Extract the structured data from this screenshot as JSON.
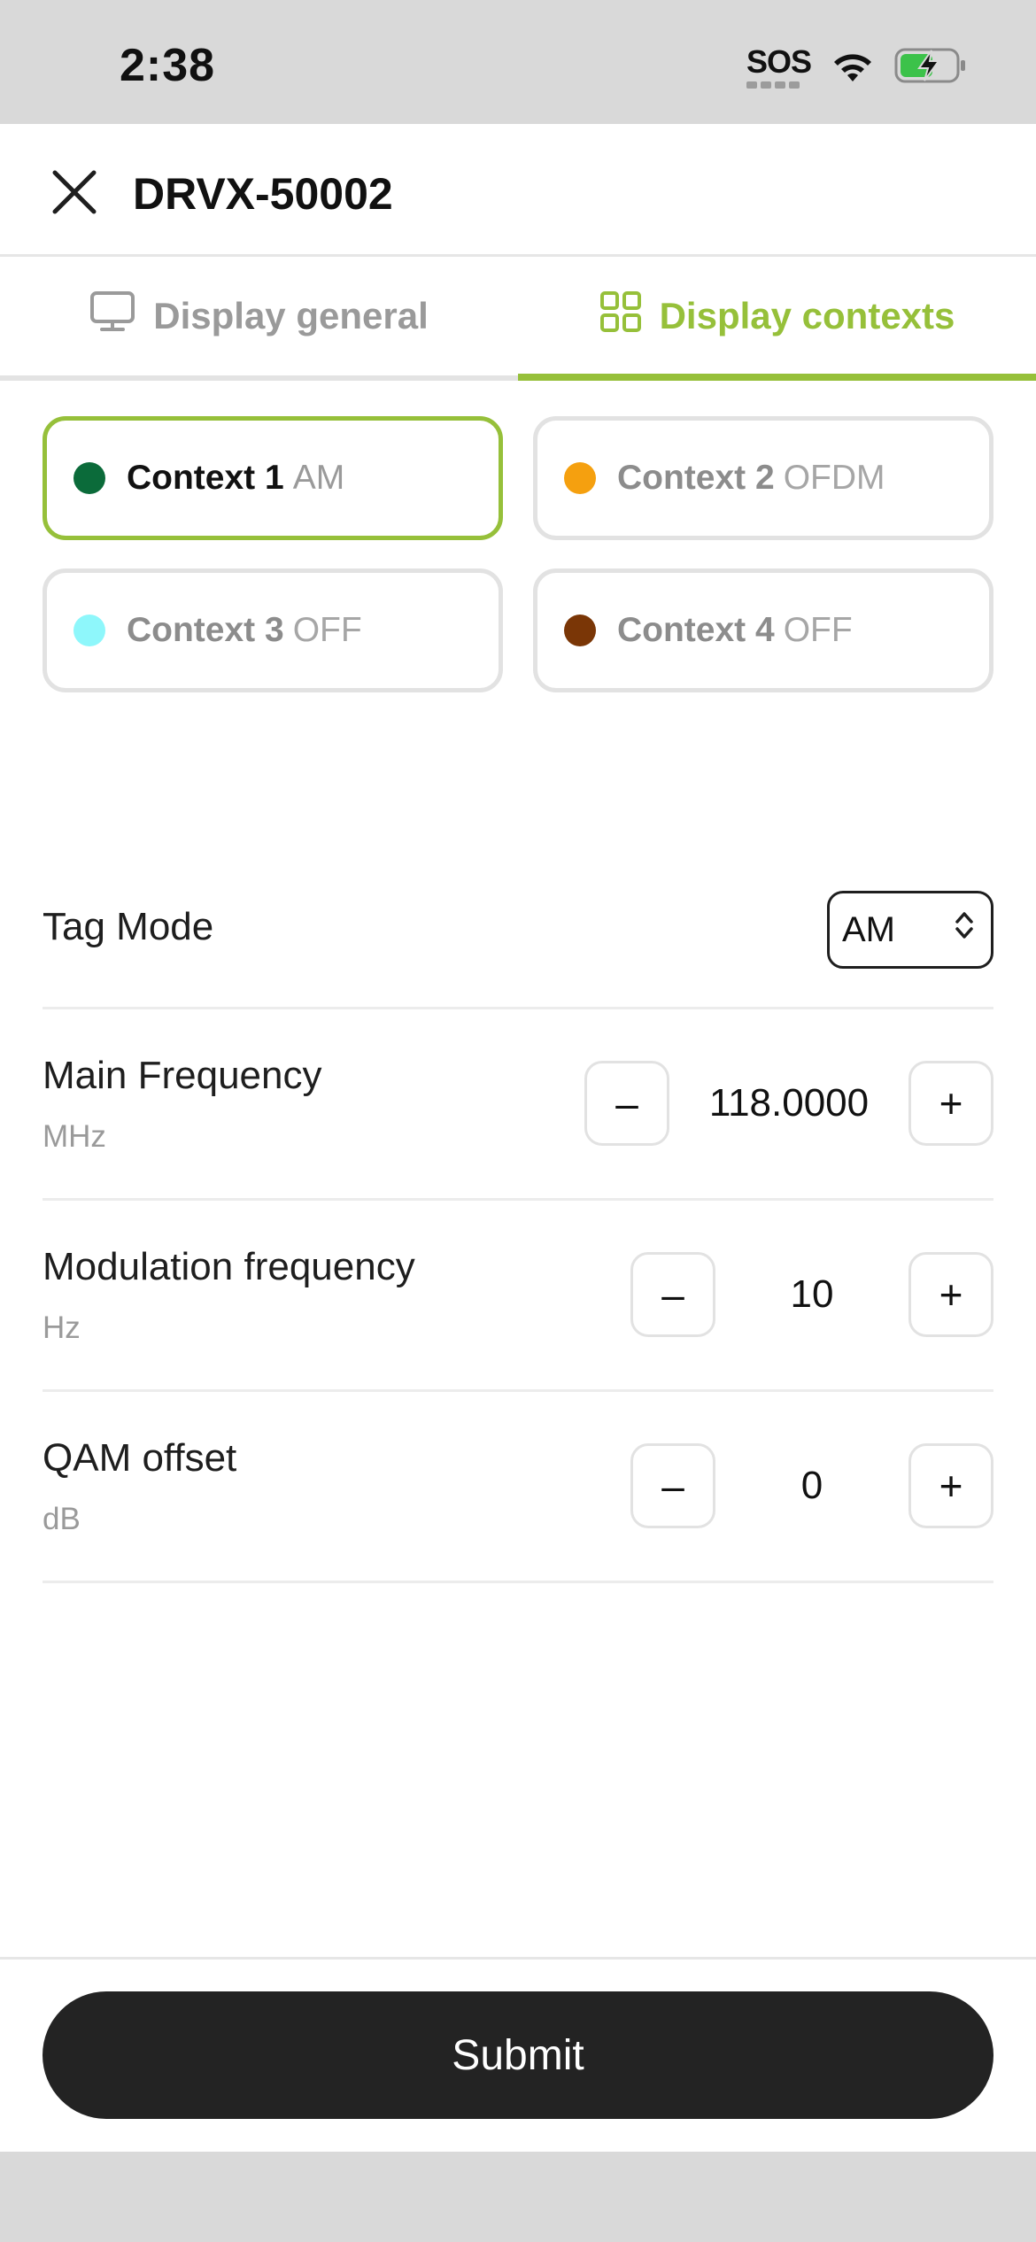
{
  "status": {
    "time": "2:38",
    "sos": "SOS"
  },
  "header": {
    "title": "DRVX-50002",
    "close_icon": "close-icon"
  },
  "tabs": [
    {
      "label": "Display general",
      "icon": "monitor-icon",
      "active": false
    },
    {
      "label": "Display contexts",
      "icon": "grid-icon",
      "active": true
    }
  ],
  "contexts": [
    {
      "name": "Context 1",
      "mode": "AM",
      "color": "#0b6b3a",
      "active": true
    },
    {
      "name": "Context 2",
      "mode": "OFDM",
      "color": "#f5a00f",
      "active": false
    },
    {
      "name": "Context 3",
      "mode": "OFF",
      "color": "#8ef7fb",
      "active": false
    },
    {
      "name": "Context 4",
      "mode": "OFF",
      "color": "#7a3606",
      "active": false
    }
  ],
  "tag_mode": {
    "label": "Tag Mode",
    "value": "AM"
  },
  "fields": [
    {
      "label": "Main Frequency",
      "unit": "MHz",
      "value": "118.0000"
    },
    {
      "label": "Modulation frequency",
      "unit": "Hz",
      "value": "10"
    },
    {
      "label": "QAM offset",
      "unit": "dB",
      "value": "0"
    }
  ],
  "stepper": {
    "minus": "–",
    "plus": "+"
  },
  "footer": {
    "submit_label": "Submit"
  },
  "colors": {
    "accent": "#96c03a",
    "button_dark": "#232323"
  }
}
